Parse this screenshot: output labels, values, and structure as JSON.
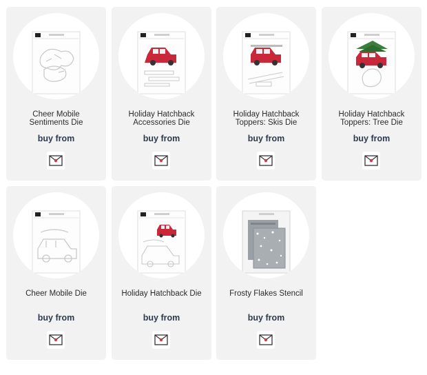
{
  "products": [
    {
      "title_line1": "Cheer Mobile",
      "title_line2": "Sentiments Die",
      "buy_label": "buy from",
      "retailer_icon": "retailer-logo-icon",
      "image": "die-sentiments"
    },
    {
      "title_line1": "Holiday Hatchback",
      "title_line2": "Accessories Die",
      "buy_label": "buy from",
      "retailer_icon": "retailer-logo-icon",
      "image": "car-accessories"
    },
    {
      "title_line1": "Holiday Hatchback",
      "title_line2": "Toppers: Skis Die",
      "buy_label": "buy from",
      "retailer_icon": "retailer-logo-icon",
      "image": "car-skis"
    },
    {
      "title_line1": "Holiday Hatchback",
      "title_line2": "Toppers: Tree Die",
      "buy_label": "buy from",
      "retailer_icon": "retailer-logo-icon",
      "image": "car-tree"
    },
    {
      "title_line1": "Cheer Mobile Die",
      "title_line2": "",
      "buy_label": "buy from",
      "retailer_icon": "retailer-logo-icon",
      "image": "die-cheer-mobile"
    },
    {
      "title_line1": "Holiday Hatchback Die",
      "title_line2": "",
      "buy_label": "buy from",
      "retailer_icon": "retailer-logo-icon",
      "image": "car-die"
    },
    {
      "title_line1": "Frosty Flakes Stencil",
      "title_line2": "",
      "buy_label": "buy from",
      "retailer_icon": "retailer-logo-icon",
      "image": "stencil"
    }
  ],
  "colors": {
    "card_bg": "#f2f2f2",
    "car_red": "#c8283a",
    "buy_text": "#2e3a4b",
    "brand_black": "#222222"
  }
}
